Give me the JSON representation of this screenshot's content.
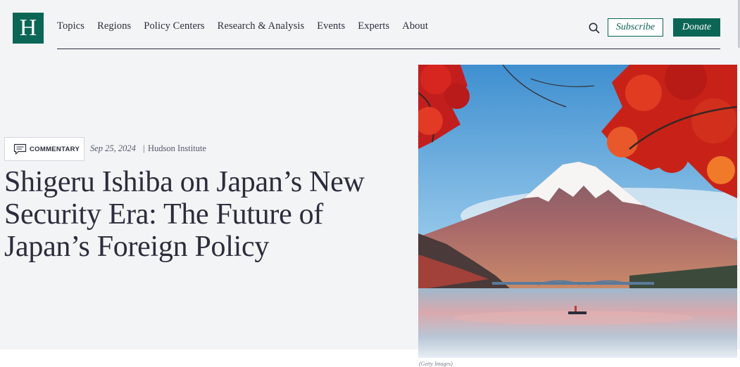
{
  "site": {
    "logo_letter": "H"
  },
  "nav": {
    "items": [
      "Topics",
      "Regions",
      "Policy Centers",
      "Research & Analysis",
      "Events",
      "Experts",
      "About"
    ]
  },
  "header": {
    "subscribe_label": "Subscribe",
    "donate_label": "Donate",
    "search_icon": "search-icon"
  },
  "article": {
    "type_label": "COMMENTARY",
    "type_icon": "speech-bubble-icon",
    "date": "Sep 25, 2024",
    "separator": "|",
    "author": "Hudson Institute",
    "title": "Shigeru Ishiba on Japan’s New Security Era: The Future of Japan’s Foreign Policy"
  },
  "hero": {
    "credit": "(Getty Images)"
  },
  "colors": {
    "brand": "#0c6656",
    "text": "#2b2d3c",
    "background": "#f3f4f6"
  }
}
